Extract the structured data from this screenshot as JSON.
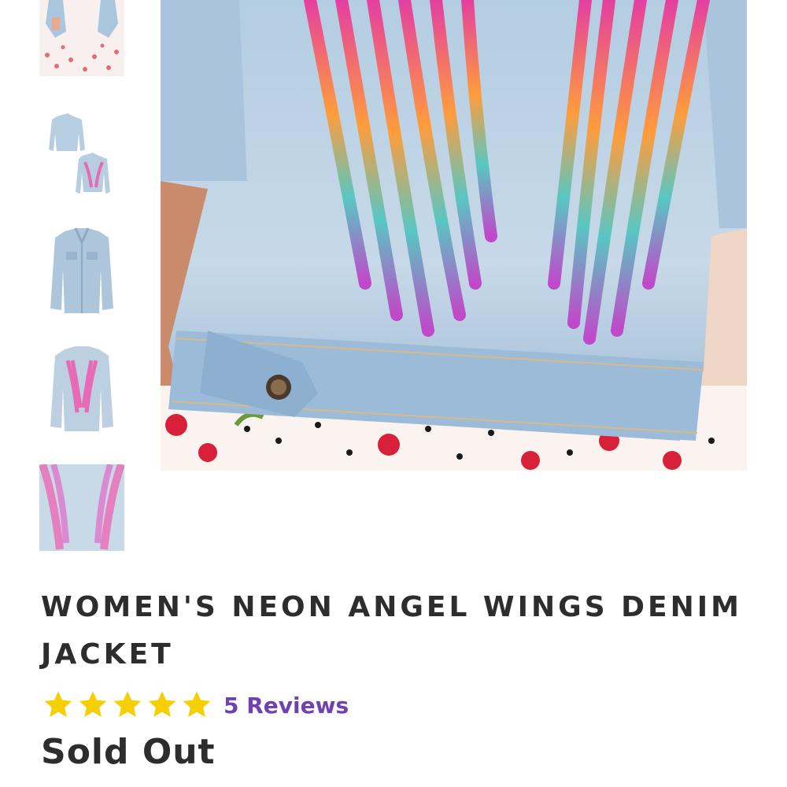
{
  "product": {
    "title": "WOMEN'S NEON ANGEL WINGS DENIM JACKET",
    "rating": 5,
    "reviews_label": "5 Reviews",
    "status": "Sold Out"
  },
  "colors": {
    "title": "#2d2d2d",
    "star": "#f5cf00",
    "reviews_link": "#7041b0",
    "denim": "#a7c4de"
  },
  "thumbnails": [
    {
      "name": "thumbnail-model-front"
    },
    {
      "name": "thumbnail-jacket-front-back"
    },
    {
      "name": "thumbnail-jacket-front"
    },
    {
      "name": "thumbnail-jacket-back-wings"
    },
    {
      "name": "thumbnail-wings-closeup"
    }
  ]
}
